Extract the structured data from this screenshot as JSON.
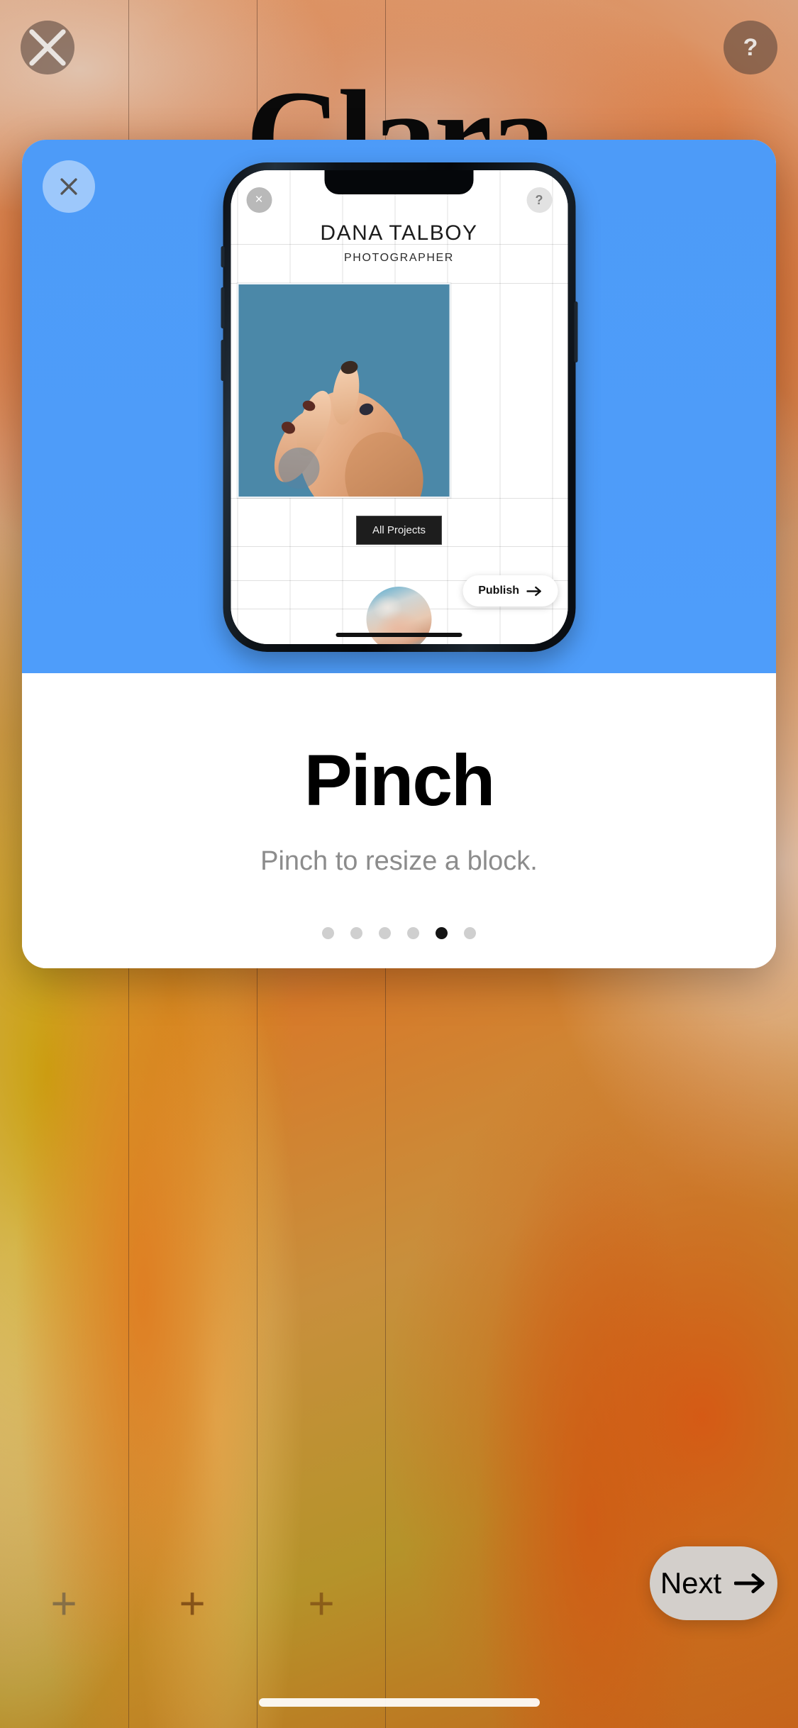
{
  "canvas": {
    "site_title": "Clara",
    "close_icon": "close-icon",
    "help_icon": "help-icon",
    "help_label": "?",
    "add_block_icons": [
      "plus-icon",
      "plus-icon",
      "plus-icon"
    ],
    "add_block_label": "+"
  },
  "modal": {
    "close_icon": "close-icon",
    "title": "Pinch",
    "description": "Pinch to resize a block.",
    "accent_color": "#4e9cf8",
    "pagination": {
      "total": 6,
      "active_index": 5
    }
  },
  "phone_preview": {
    "close_icon": "close-icon",
    "close_label": "×",
    "help_icon": "help-icon",
    "help_label": "?",
    "site_name": "DANA TALBOY",
    "site_role": "PHOTOGRAPHER",
    "all_projects_label": "All Projects",
    "publish_label": "Publish",
    "publish_arrow_icon": "arrow-right-icon",
    "hero_image": "portrait-photo",
    "avatar_image": "avatar-photo"
  },
  "footer": {
    "next_label": "Next",
    "next_arrow_icon": "arrow-right-icon"
  }
}
